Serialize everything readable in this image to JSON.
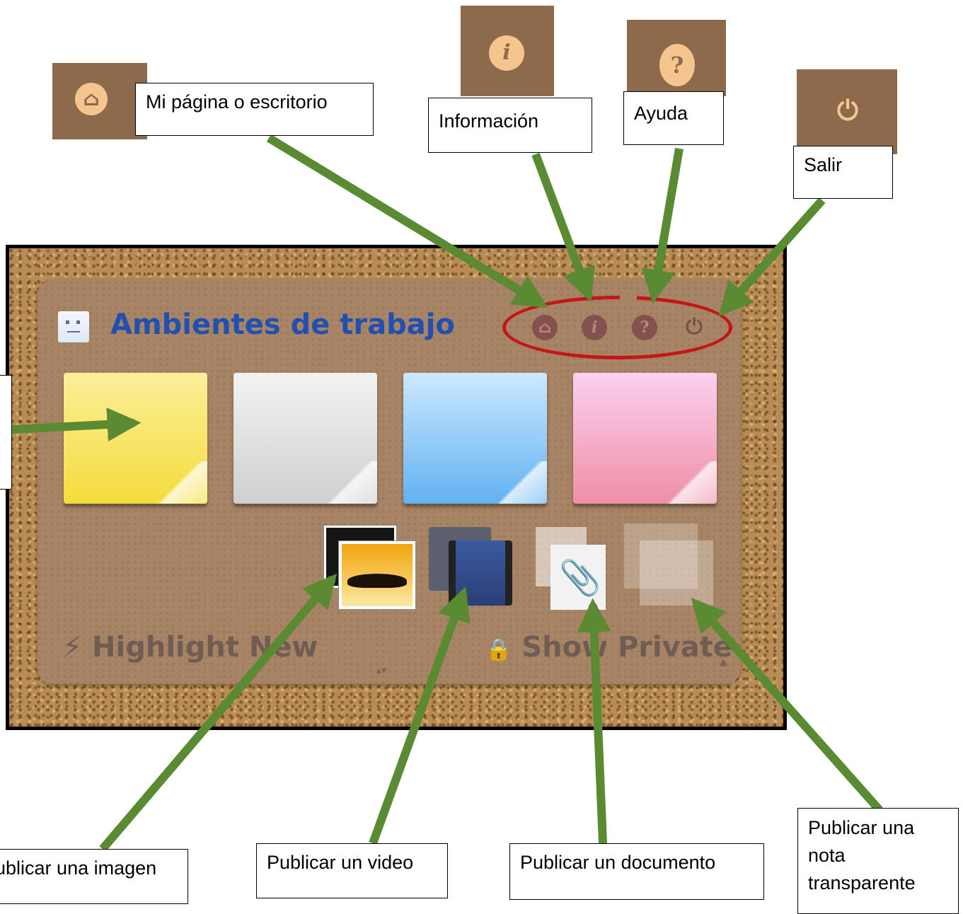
{
  "panel": {
    "title": "Ambientes de trabajo",
    "highlight_label": "Highlight New",
    "private_label": "Show Private",
    "top_icons": [
      "home-icon",
      "info-icon",
      "help-icon",
      "power-icon"
    ],
    "notes": [
      {
        "name": "yellow-note",
        "color": "#f5dc3c"
      },
      {
        "name": "grey-note",
        "color": "#d0d0d0"
      },
      {
        "name": "blue-note",
        "color": "#62b2f2"
      },
      {
        "name": "pink-note",
        "color": "#f08fa8"
      }
    ],
    "media_icons": [
      "image-icon",
      "video-icon",
      "document-icon",
      "transparent-note-icon"
    ]
  },
  "callouts": {
    "home": "Mi página o escritorio",
    "info": "Información",
    "help": "Ayuda",
    "exit": "Salir",
    "image": "Publicar una imagen",
    "video": "Publicar un video",
    "document": "Publicar un documento",
    "transparent": "Publicar una nota transparente"
  },
  "glyphs": {
    "info": "i",
    "help": "?",
    "power": "⏻",
    "bolt": "⚡",
    "lock": "🔒"
  },
  "colors": {
    "arrow": "#5a8a32",
    "ellipse": "#c41616",
    "title": "#2150b0",
    "cork": "#b98c55"
  }
}
